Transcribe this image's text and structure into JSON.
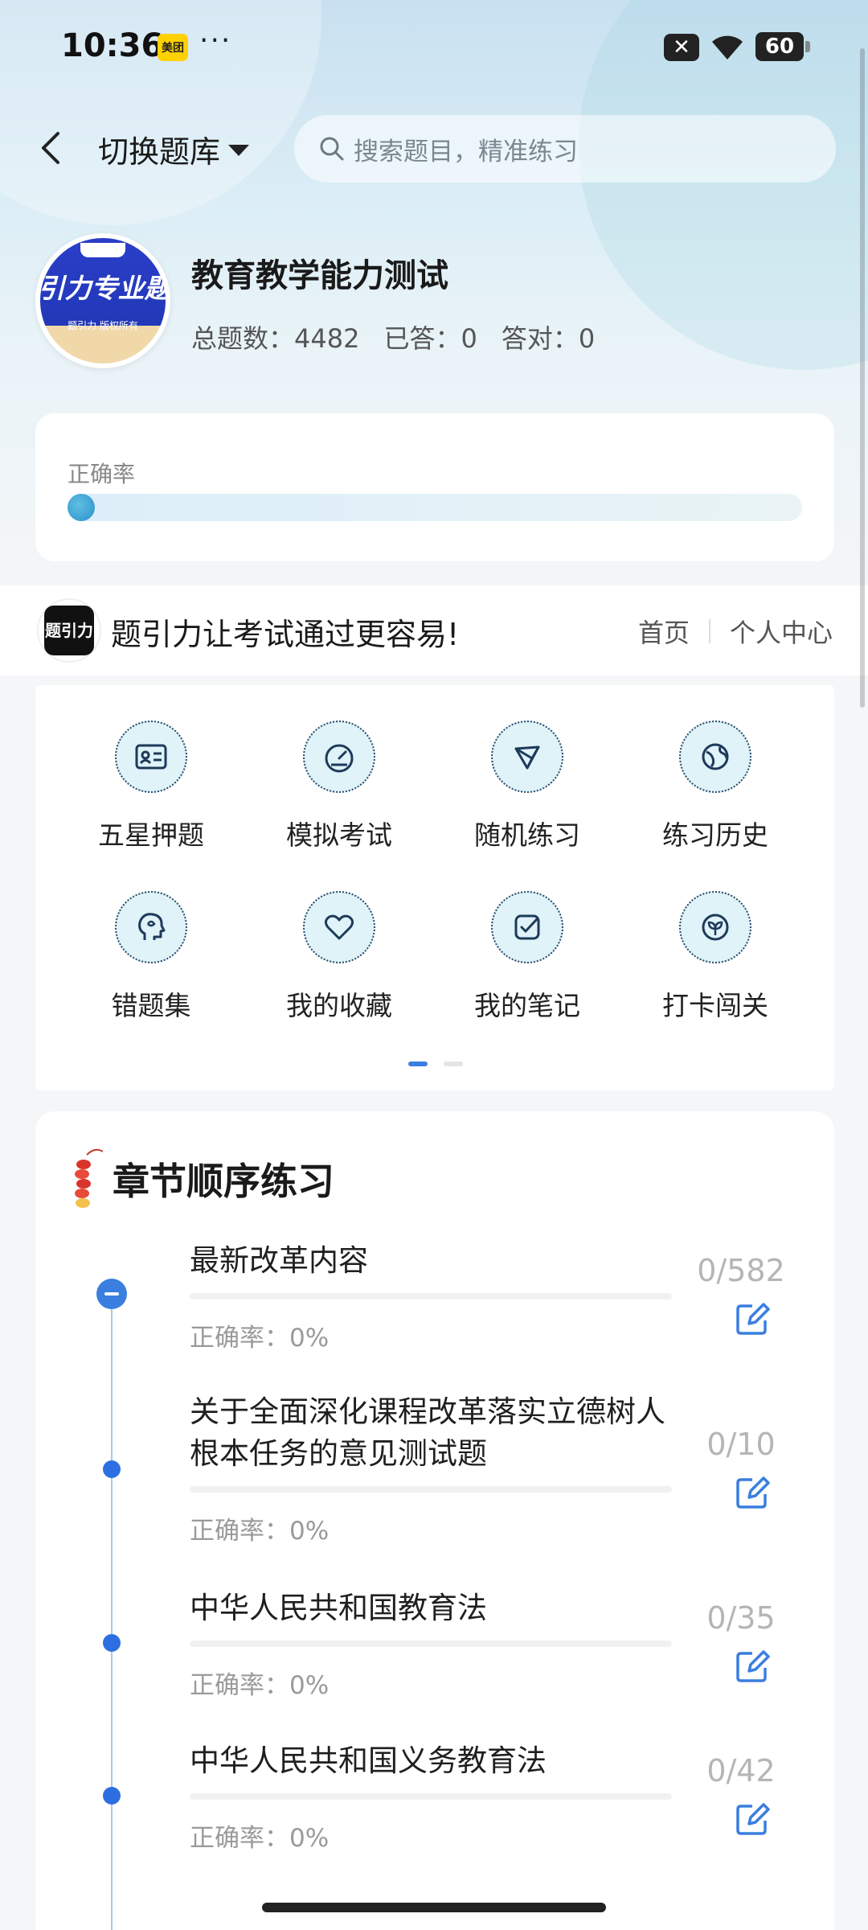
{
  "status_bar": {
    "time": "10:36",
    "meituan_label": "美团",
    "dots": "···",
    "battery": "60"
  },
  "header": {
    "switch_bank_label": "切换题库",
    "search_placeholder": "搜索题目，精准练习"
  },
  "bank": {
    "logo_text": "引力专业题",
    "logo_sub": "题引力 版权所有",
    "title": "教育教学能力测试",
    "total_label": "总题数：4482",
    "answered_label": "已答：0",
    "correct_label": "答对：0"
  },
  "accuracy": {
    "label": "正确率",
    "value_percent": 0
  },
  "promo": {
    "logo_text": "题引力",
    "text": "题引力让考试通过更容易!",
    "home_link": "首页",
    "profile_link": "个人中心"
  },
  "features": [
    {
      "label": "五星押题",
      "icon": "id-card-icon"
    },
    {
      "label": "模拟考试",
      "icon": "gauge-icon"
    },
    {
      "label": "随机练习",
      "icon": "network-icon"
    },
    {
      "label": "练习历史",
      "icon": "globe-icon"
    },
    {
      "label": "错题集",
      "icon": "brain-head-icon"
    },
    {
      "label": "我的收藏",
      "icon": "heart-icon"
    },
    {
      "label": "我的笔记",
      "icon": "checkbox-icon"
    },
    {
      "label": "打卡闯关",
      "icon": "sprout-icon"
    }
  ],
  "pagination": {
    "pages": 2,
    "active": 0
  },
  "chapters": {
    "title": "章节顺序练习",
    "items": [
      {
        "name": "最新改革内容",
        "count": "0/582",
        "accuracy": "正确率：0%"
      },
      {
        "name": "关于全面深化课程改革落实立德树人根本任务的意见测试题",
        "count": "0/10",
        "accuracy": "正确率：0%"
      },
      {
        "name": "中华人民共和国教育法",
        "count": "0/35",
        "accuracy": "正确率：0%"
      },
      {
        "name": "中华人民共和国义务教育法",
        "count": "0/42",
        "accuracy": "正确率：0%"
      }
    ]
  },
  "colors": {
    "accent": "#3a7ee0",
    "timeline": "#2d6fe0",
    "icon_bg": "#dff3f8",
    "icon_stroke": "#2a4a6a"
  }
}
